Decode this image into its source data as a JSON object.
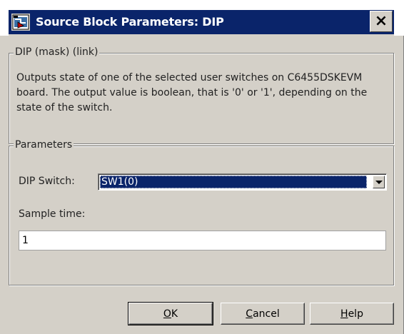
{
  "window": {
    "title": "Source Block Parameters: DIP",
    "close_glyph": "×"
  },
  "mask_group": {
    "legend": "DIP (mask) (link)",
    "description": "Outputs state of one of the selected user switches on C6455DSKEVM board.  The output value is boolean, that is '0' or '1', depending on the state of the switch."
  },
  "parameters_group": {
    "legend": "Parameters",
    "dip_switch": {
      "label": "DIP Switch:",
      "selected": "SW1(0)"
    },
    "sample_time": {
      "label": "Sample time:",
      "value": "1"
    }
  },
  "buttons": {
    "ok": {
      "mnemonic": "O",
      "rest": "K"
    },
    "cancel": {
      "mnemonic": "C",
      "rest": "ancel"
    },
    "help": {
      "mnemonic": "H",
      "rest": "elp"
    }
  },
  "icons": {
    "app": "simulink-block-icon",
    "close": "close-icon",
    "dropdown": "chevron-down-icon"
  },
  "colors": {
    "titlebar": "#0a246a",
    "dialog_bg": "#d4d0c8",
    "selection": "#0a246a"
  }
}
